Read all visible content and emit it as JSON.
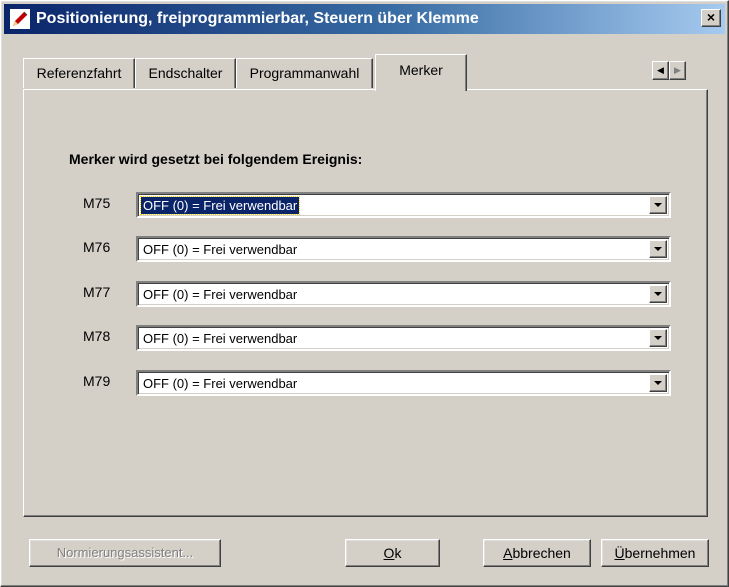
{
  "window": {
    "title": "Positionierung, freiprogrammierbar, Steuern über Klemme",
    "close_glyph": "×",
    "icon": "pencil-icon"
  },
  "tabs": [
    {
      "label": "Referenzfahrt",
      "active": false
    },
    {
      "label": "Endschalter",
      "active": false
    },
    {
      "label": "Programmanwahl",
      "active": false
    },
    {
      "label": "Merker",
      "active": true
    }
  ],
  "tab_scroll": {
    "left": "◀",
    "right": "▶"
  },
  "section": {
    "heading": "Merker wird gesetzt bei folgendem Ereignis:"
  },
  "markers": [
    {
      "label": "M75",
      "value": "OFF (0) = Frei verwendbar",
      "selected": true
    },
    {
      "label": "M76",
      "value": "OFF (0) = Frei verwendbar",
      "selected": false
    },
    {
      "label": "M77",
      "value": "OFF (0) = Frei verwendbar",
      "selected": false
    },
    {
      "label": "M78",
      "value": "OFF (0) = Frei verwendbar",
      "selected": false
    },
    {
      "label": "M79",
      "value": "OFF (0) = Frei verwendbar",
      "selected": false
    }
  ],
  "buttons": {
    "wizard": "Normierungsassistent...",
    "ok_first": "O",
    "ok_rest": "k",
    "cancel_first": "A",
    "cancel_rest": "bbrechen",
    "apply_first": "Ü",
    "apply_rest": "bernehmen"
  },
  "colors": {
    "face": "#d4d0c8",
    "title_start": "#0a246a",
    "title_end": "#a6caf0",
    "selection": "#0a246a"
  }
}
